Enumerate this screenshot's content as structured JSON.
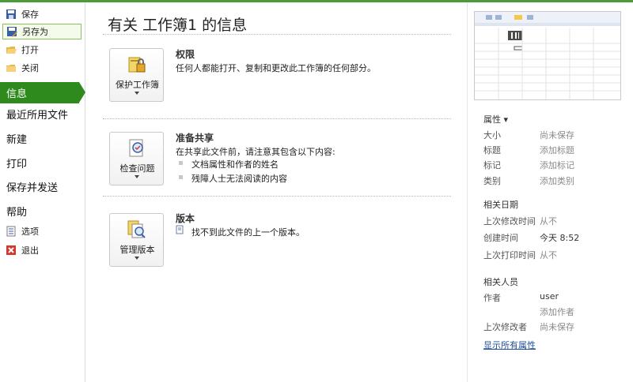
{
  "sidebar": {
    "small_top": [
      {
        "label": "保存",
        "icon": "save-icon"
      },
      {
        "label": "另存为",
        "icon": "save-as-icon"
      },
      {
        "label": "打开",
        "icon": "open-folder-icon"
      },
      {
        "label": "关闭",
        "icon": "close-folder-icon"
      }
    ],
    "info": "信息",
    "big": [
      "最近所用文件",
      "新建",
      "打印",
      "保存并发送",
      "帮助"
    ],
    "small_bottom": [
      {
        "label": "选项",
        "icon": "options-icon"
      },
      {
        "label": "退出",
        "icon": "exit-icon"
      }
    ]
  },
  "main": {
    "title": "有关 工作簿1 的信息",
    "sections": [
      {
        "button": "保护工作簿",
        "heading": "权限",
        "text": "任何人都能打开、复制和更改此工作簿的任何部分。"
      },
      {
        "button": "检查问题",
        "heading": "准备共享",
        "text": "在共享此文件前，请注意其包含以下内容:",
        "bullets": [
          "文档属性和作者的姓名",
          "残障人士无法阅读的内容"
        ]
      },
      {
        "button": "管理版本",
        "heading": "版本",
        "text": "找不到此文件的上一个版本。"
      }
    ]
  },
  "properties": {
    "heading": "属性 ▾",
    "rows": [
      {
        "key": "大小",
        "value": "尚未保存"
      },
      {
        "key": "标题",
        "value": "添加标题"
      },
      {
        "key": "标记",
        "value": "添加标记"
      },
      {
        "key": "类别",
        "value": "添加类别"
      }
    ],
    "dates_heading": "相关日期",
    "dates": [
      {
        "key": "上次修改时间",
        "value": "从不"
      },
      {
        "key": "创建时间",
        "value": "今天 8:52"
      },
      {
        "key": "上次打印时间",
        "value": "从不"
      }
    ],
    "people_heading": "相关人员",
    "author_key": "作者",
    "author_value": "user",
    "add_author": "添加作者",
    "last_modified_by_key": "上次修改者",
    "last_modified_by_value": "尚未保存",
    "show_all": "显示所有属性"
  },
  "colors": {
    "accent": "#2f8a1e",
    "link": "#1f4e99"
  }
}
